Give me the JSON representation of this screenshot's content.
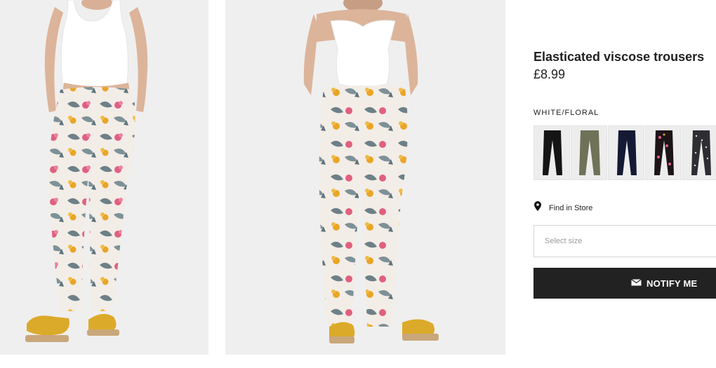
{
  "product": {
    "title": "Elasticated viscose trousers",
    "price": "£8.99",
    "color_name": "WHITE/FLORAL"
  },
  "swatches": [
    {
      "color": "#151515",
      "pattern": "solid"
    },
    {
      "color": "#6f7257",
      "pattern": "solid"
    },
    {
      "color": "#141a34",
      "pattern": "solid"
    },
    {
      "color": "#1d1418",
      "pattern": "floral"
    },
    {
      "color": "#2e2e32",
      "pattern": "dotted"
    }
  ],
  "find_in_store": {
    "label": "Find in Store",
    "icon": "location-pin-icon"
  },
  "size_select": {
    "placeholder": "Select size"
  },
  "notify": {
    "label": "NOTIFY ME",
    "icon": "envelope-icon"
  },
  "colors": {
    "button_bg": "#222222",
    "photo_bg": "#efefef",
    "pants_base": "#f3ede7",
    "flower_pink": "#e0607f",
    "flower_yellow": "#e9a526",
    "leaf": "#6d8088",
    "sandal": "#dcaa2a"
  }
}
